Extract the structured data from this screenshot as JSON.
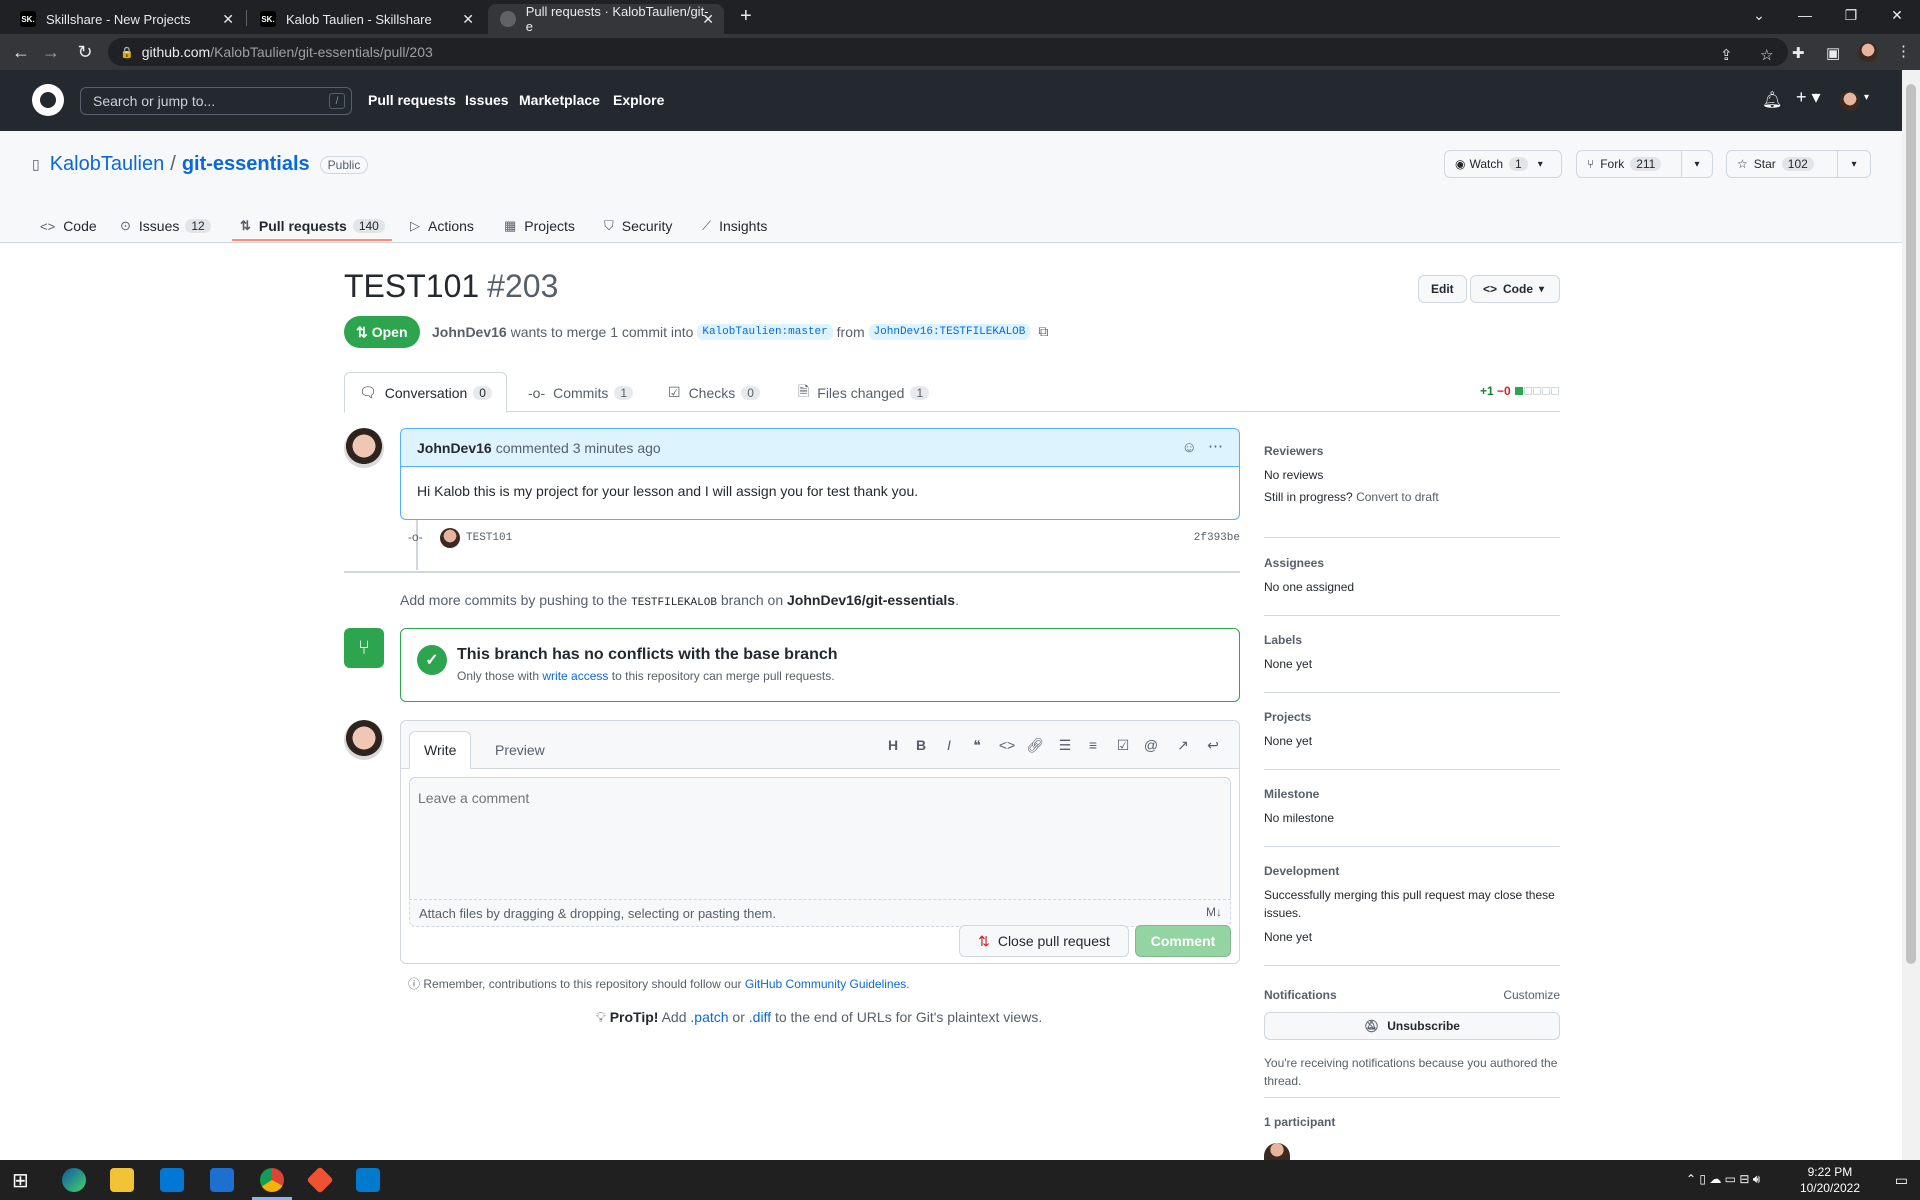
{
  "browser": {
    "tabs": [
      {
        "label": "Skillshare - New Projects",
        "favicon": "SK."
      },
      {
        "label": "Kalob Taulien - Skillshare",
        "favicon": "SK."
      },
      {
        "label": "Pull requests · KalobTaulien/git-e",
        "favicon": ""
      }
    ],
    "url_host": "github.com",
    "url_path": "/KalobTaulien/git-essentials/pull/203"
  },
  "gh_header": {
    "search_placeholder": "Search or jump to...",
    "slash": "/",
    "nav": [
      "Pull requests",
      "Issues",
      "Marketplace",
      "Explore"
    ]
  },
  "repo": {
    "owner": "KalobTaulien",
    "separator": "/",
    "name": "git-essentials",
    "visibility": "Public",
    "watch_label": "Watch",
    "watch_count": "1",
    "fork_label": "Fork",
    "fork_count": "211",
    "star_label": "Star",
    "star_count": "102",
    "tabs": [
      {
        "label": "Code",
        "count": ""
      },
      {
        "label": "Issues",
        "count": "12"
      },
      {
        "label": "Pull requests",
        "count": "140"
      },
      {
        "label": "Actions",
        "count": ""
      },
      {
        "label": "Projects",
        "count": ""
      },
      {
        "label": "Security",
        "count": ""
      },
      {
        "label": "Insights",
        "count": ""
      }
    ]
  },
  "pr": {
    "title": "TEST101",
    "number": "#203",
    "edit_label": "Edit",
    "code_label": "Code",
    "state": "Open",
    "author": "JohnDev16",
    "meta_text": "wants to merge 1 commit into",
    "base": "KalobTaulien:master",
    "from_word": "from",
    "head": "JohnDev16:TESTFILEKALOB",
    "tabs": [
      {
        "label": "Conversation",
        "count": "0"
      },
      {
        "label": "Commits",
        "count": "1"
      },
      {
        "label": "Checks",
        "count": "0"
      },
      {
        "label": "Files changed",
        "count": "1"
      }
    ],
    "additions": "+1",
    "deletions": "−0"
  },
  "comment": {
    "author": "JohnDev16",
    "meta": "commented 3 minutes ago",
    "body": "Hi Kalob this is my project for your lesson and I will assign you for test thank you."
  },
  "commit": {
    "message": "TEST101",
    "sha": "2f393be"
  },
  "push_hint": {
    "prefix": "Add more commits by pushing to the",
    "branch": "TESTFILEKALOB",
    "middle": "branch on",
    "repo": "JohnDev16/git-essentials",
    "suffix": "."
  },
  "merge": {
    "title": "This branch has no conflicts with the base branch",
    "sub_prefix": "Only those with",
    "sub_link": "write access",
    "sub_suffix": "to this repository can merge pull requests."
  },
  "form": {
    "write_tab": "Write",
    "preview_tab": "Preview",
    "placeholder": "Leave a comment",
    "attach": "Attach files by dragging & dropping, selecting or pasting them.",
    "close_label": "Close pull request",
    "comment_label": "Comment"
  },
  "guidelines": {
    "prefix": "Remember, contributions to this repository should follow our",
    "link": "GitHub Community Guidelines",
    "suffix": "."
  },
  "protip": {
    "label": "ProTip!",
    "t1": "Add",
    "patch": ".patch",
    "t2": "or",
    "diff": ".diff",
    "t3": "to the end of URLs for Git's plaintext views."
  },
  "sidebar": {
    "reviewers": {
      "heading": "Reviewers",
      "value": "No reviews",
      "draft_prefix": "Still in progress?",
      "draft_link": "Convert to draft"
    },
    "assignees": {
      "heading": "Assignees",
      "value": "No one assigned"
    },
    "labels": {
      "heading": "Labels",
      "value": "None yet"
    },
    "projects": {
      "heading": "Projects",
      "value": "None yet"
    },
    "milestone": {
      "heading": "Milestone",
      "value": "No milestone"
    },
    "development": {
      "heading": "Development",
      "desc": "Successfully merging this pull request may close these issues.",
      "value": "None yet"
    },
    "notifications": {
      "heading": "Notifications",
      "customize": "Customize",
      "unsubscribe": "Unsubscribe",
      "reason": "You're receiving notifications because you authored the thread."
    },
    "participants": {
      "heading": "1 participant"
    }
  },
  "taskbar": {
    "time": "9:22 PM",
    "date": "10/20/2022"
  },
  "colors": {
    "accent": "#0969da",
    "open_green": "#2da44e",
    "header_bg": "#24292f"
  }
}
